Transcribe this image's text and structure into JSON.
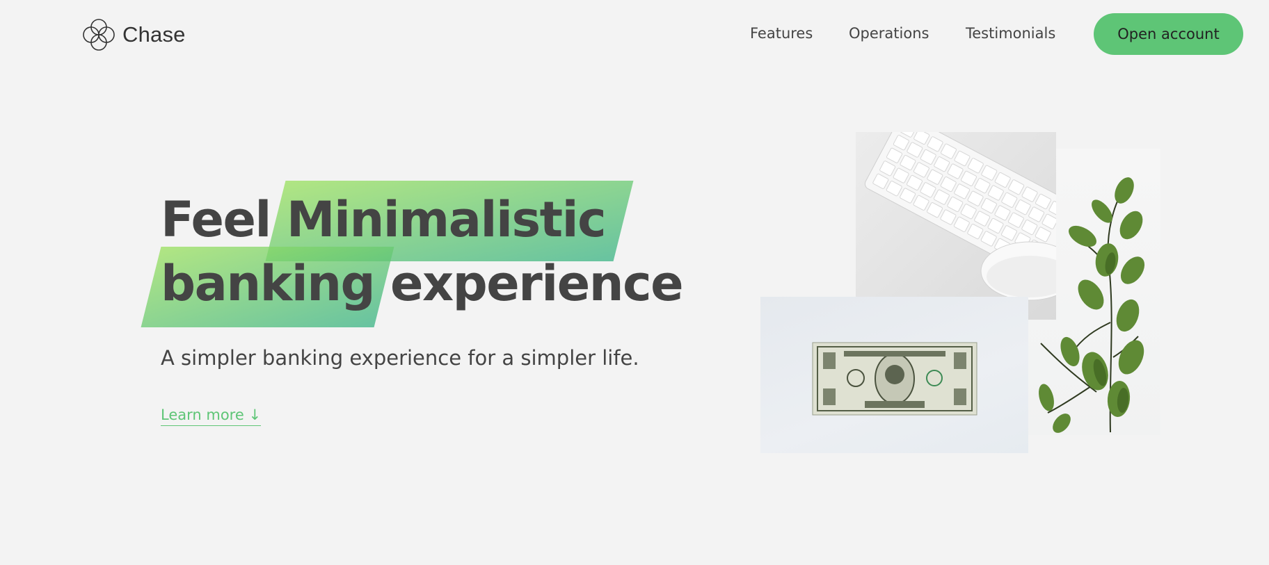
{
  "nav": {
    "brand": "Chase",
    "logo_icon": "four-circles-logo-icon",
    "links": [
      "Features",
      "Operations",
      "Testimonials"
    ],
    "cta": "Open account"
  },
  "hero": {
    "title_line1_plain": "Feel",
    "title_line1_highlight": "Minimalistic",
    "title_line2_highlight": "banking",
    "title_line2_plain": "experience",
    "subtitle": "A simpler banking experience for a simpler life.",
    "learn_more": "Learn more ↓"
  },
  "images": [
    "keyboard-and-mouse-photo",
    "eucalyptus-plant-photo",
    "one-dollar-bill-photo"
  ],
  "colors": {
    "accent": "#5ec576",
    "gradient_start": "#9be15d",
    "gradient_end": "#39b385",
    "background": "#f3f3f3",
    "text": "#444444"
  }
}
